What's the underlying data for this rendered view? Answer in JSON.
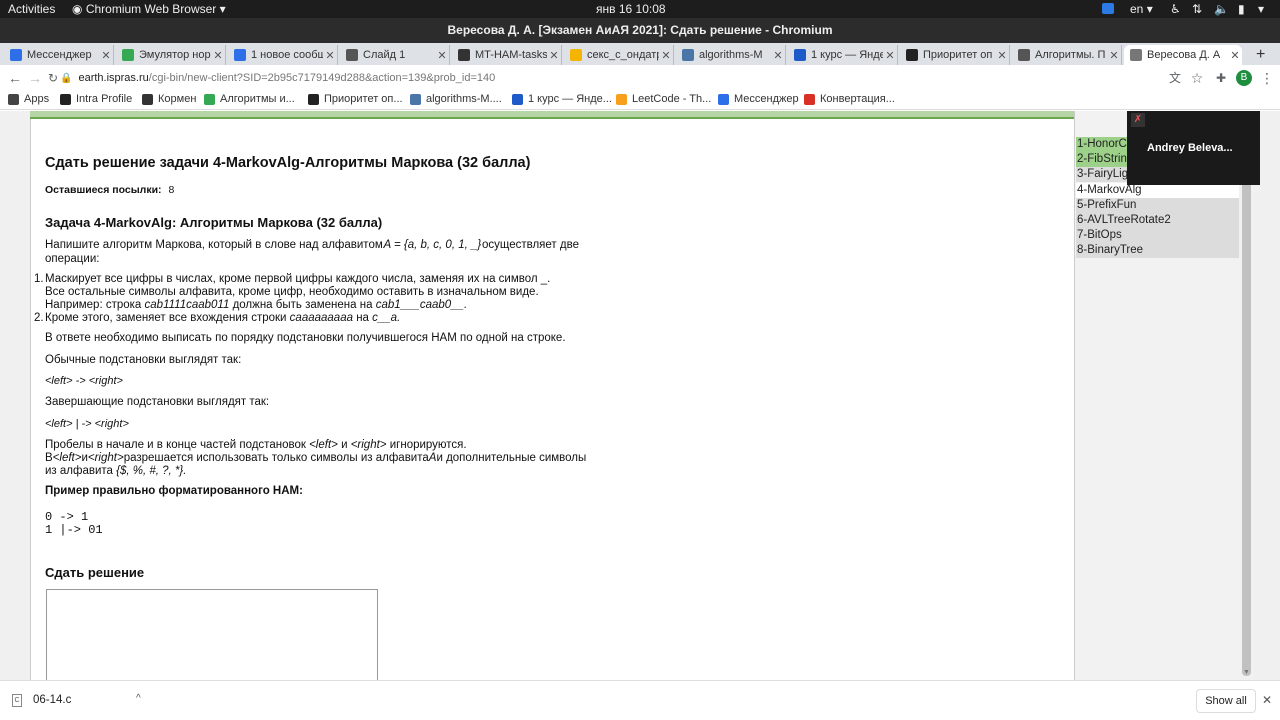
{
  "topbar": {
    "activities": "Activities",
    "app": "Chromium Web Browser",
    "clock": "янв 16  10:08",
    "lang": "en"
  },
  "window": {
    "title": "Вересова Д. А. [Экзамен АиАЯ 2021]: Сдать решение - Chromium"
  },
  "tabs": [
    {
      "label": "Мессенджер",
      "icon": "messenger-icon",
      "color": "#2c6fe8"
    },
    {
      "label": "Эмулятор нор",
      "icon": "globe-icon",
      "color": "#34a853"
    },
    {
      "label": "1 новое сообщ",
      "icon": "messenger-icon",
      "color": "#2c6fe8"
    },
    {
      "label": "Слайд 1",
      "icon": "globe-icon",
      "color": "#555555"
    },
    {
      "label": "MT-HAM-tasks",
      "icon": "github-icon",
      "color": "#333333"
    },
    {
      "label": "секс_с_ондатр",
      "icon": "doc-icon",
      "color": "#f4b400"
    },
    {
      "label": "algorithms-M",
      "icon": "vk-icon",
      "color": "#4a76a8"
    },
    {
      "label": "1 курс — Янде",
      "icon": "yandex-icon",
      "color": "#1e5ac8"
    },
    {
      "label": "Приоритет оп",
      "icon": "yandex-icon",
      "color": "#222222"
    },
    {
      "label": "Алгоритмы. П",
      "icon": "globe-icon",
      "color": "#555555"
    },
    {
      "label": "Вересова Д. А",
      "icon": "page-icon",
      "color": "#777777"
    }
  ],
  "toolbar": {
    "url_host": "earth.ispras.ru",
    "url_path": "/cgi-bin/new-client?SID=2b95c7179149d288&action=139&prob_id=140",
    "profile_initial": "B"
  },
  "bookmarks": [
    {
      "label": "Apps",
      "icon": "apps-icon",
      "color": "#444444"
    },
    {
      "label": "Intra Profile",
      "icon": "42-icon",
      "color": "#222222"
    },
    {
      "label": "Кормен",
      "icon": "globe-icon",
      "color": "#333333"
    },
    {
      "label": "Алгоритмы и...",
      "icon": "globe-icon",
      "color": "#34a853"
    },
    {
      "label": "Приоритет оп...",
      "icon": "yandex-icon",
      "color": "#222222"
    },
    {
      "label": "algorithms-M....",
      "icon": "vk-icon",
      "color": "#4a76a8"
    },
    {
      "label": "1 курс — Янде...",
      "icon": "yandex-icon",
      "color": "#1e5ac8"
    },
    {
      "label": "LeetCode - Th...",
      "icon": "leetcode-icon",
      "color": "#f89f1b"
    },
    {
      "label": "Мессенджер",
      "icon": "messenger-icon",
      "color": "#2c6fe8"
    },
    {
      "label": "Конвертация...",
      "icon": "heart-icon",
      "color": "#d93025"
    }
  ],
  "page": {
    "heading": "Сдать решение задачи 4-MarkovAlg-Алгоритмы Маркова (32 балла)",
    "remaining_label": "Оставшиеся посылки:",
    "remaining_value": "8",
    "task_heading": "Задача 4-MarkovAlg: Алгоритмы Маркова (32 балла)",
    "intro_1a": "Напишите алгоритм Маркова, который в слове над алфавитом",
    "intro_1b": "A = {a, b, c, 0, 1, _}",
    "intro_1c": "осуществляет две",
    "intro_2": "операции:",
    "item1_num": "1.",
    "item1_line1": "Маскирует все цифры в числах, кроме первой цифры каждого числа, заменяя их на символ _.",
    "item1_line2": "Все остальные символы алфавита, кроме цифр, необходимо оставить в изначальном виде.",
    "item1_line3a": "Например: строка",
    "item1_line3b": "cab1111caab011",
    "item1_line3c": "должна быть заменена на",
    "item1_line3d": "cab1___caab0__.",
    "item2_num": "2.",
    "item2_a": "Кроме этого, заменяет все вхождения строки",
    "item2_b": "caaaaaaaaa",
    "item2_c": "на",
    "item2_d": "c__a.",
    "para_order": "В ответе необходимо выписать по порядку подстановки получившегося НАМ по одной на строке.",
    "para_regular": "Обычные подстановки выглядят так:",
    "regular_example": "<left> ->  <right>",
    "para_final": "Завершающие подстановки выглядят так:",
    "final_example": "<left> | ->  <right>",
    "spaces_a": "Пробелы в начале и в конце частей подстановок",
    "spaces_b": "<left>",
    "spaces_c": "и",
    "spaces_d": "<right>",
    "spaces_e": "игнорируются.",
    "allowed_1a": "В",
    "allowed_1b": "<left>",
    "allowed_1c": "и",
    "allowed_1d": "<right>",
    "allowed_1e": "разрешается использовать только символы из алфавита",
    "allowed_1f": "A",
    "allowed_1g": "и дополнительные символы",
    "allowed_2a": "из алфавита",
    "allowed_2b": "{$, %, #, ?, *}.",
    "example_heading": "Пример правильно форматированного НАМ:",
    "code_line1": "0 -> 1",
    "code_line2": "1 |-> 01",
    "submit_heading": "Сдать решение"
  },
  "problems": [
    {
      "label": "1-HonorCode",
      "state": "done"
    },
    {
      "label": "2-FibString",
      "state": "done"
    },
    {
      "label": "3-FairyLights",
      "state": "norm"
    },
    {
      "label": "4-MarkovAlg",
      "state": "cur"
    },
    {
      "label": "5-PrefixFun",
      "state": "norm"
    },
    {
      "label": "6-AVLTreeRotate2",
      "state": "norm"
    },
    {
      "label": "7-BitOps",
      "state": "norm"
    },
    {
      "label": "8-BinaryTree",
      "state": "norm"
    }
  ],
  "video": {
    "name": "Andrey Beleva..."
  },
  "downloads": {
    "file": "06-14.c",
    "show_all": "Show all"
  }
}
